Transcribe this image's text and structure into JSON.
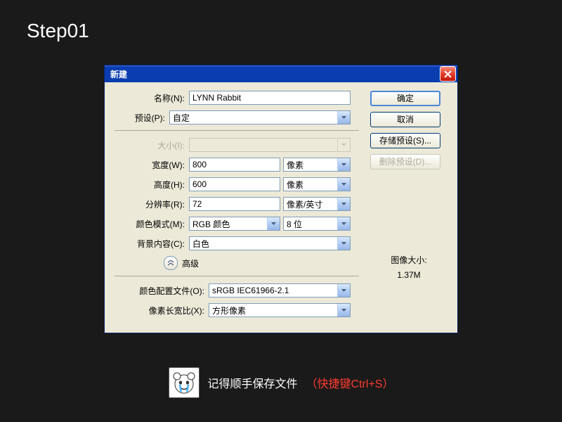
{
  "step_label": "Step01",
  "dialog": {
    "title": "新建",
    "name_label": "名称(N):",
    "name_value": "LYNN Rabbit",
    "preset_label": "预设(P):",
    "preset_value": "自定",
    "size_label": "大小(I):",
    "width_label": "宽度(W):",
    "width_value": "800",
    "width_unit": "像素",
    "height_label": "高度(H):",
    "height_value": "600",
    "height_unit": "像素",
    "resolution_label": "分辨率(R):",
    "resolution_value": "72",
    "resolution_unit": "像素/英寸",
    "colormode_label": "颜色模式(M):",
    "colormode_value": "RGB 颜色",
    "colordepth_value": "8 位",
    "bg_label": "背景内容(C):",
    "bg_value": "白色",
    "advanced_label": "高级",
    "profile_label": "颜色配置文件(O):",
    "profile_value": "sRGB IEC61966-2.1",
    "pixel_aspect_label": "像素长宽比(X):",
    "pixel_aspect_value": "方形像素"
  },
  "buttons": {
    "ok": "确定",
    "cancel": "取消",
    "save_preset": "存储预设(S)...",
    "delete_preset": "删除预设(D)..."
  },
  "image_size": {
    "label": "图像大小:",
    "value": "1.37M"
  },
  "footer": {
    "text": "记得顺手保存文件",
    "hint": "（快捷键Ctrl+S）"
  }
}
